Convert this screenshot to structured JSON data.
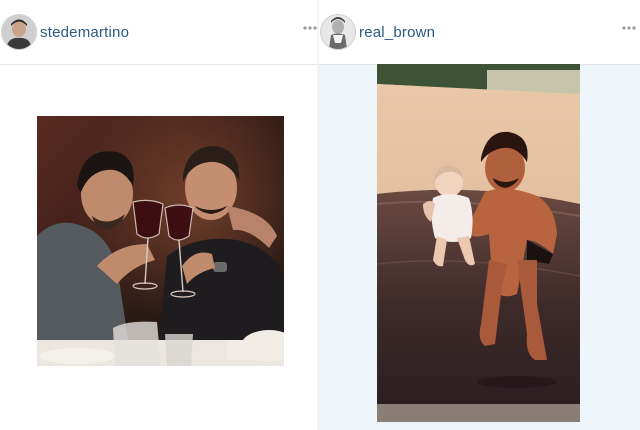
{
  "posts": [
    {
      "username": "stedemartino",
      "avatar_icon": "profile-photo-avatar",
      "more_icon": "more-options-icon",
      "photo_description_icon": "photo-two-men-toasting-wine"
    },
    {
      "username": "real_brown",
      "avatar_icon": "profile-photo-avatar",
      "more_icon": "more-options-icon",
      "photo_description_icon": "vintage-photo-man-holding-baby-at-beach"
    }
  ],
  "colors": {
    "username": "#2b5a87",
    "header_border": "#e6e6e6",
    "right_panel_bg": "#eef5fb"
  }
}
